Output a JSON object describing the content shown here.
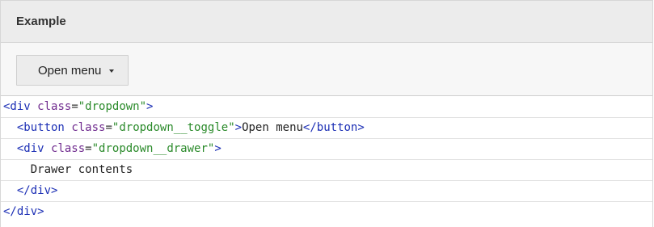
{
  "header": {
    "title": "Example"
  },
  "demo": {
    "button_label": "Open menu",
    "caret_icon": "caret-down-icon"
  },
  "code": {
    "lines": [
      [
        {
          "t": "tag",
          "v": "<div"
        },
        {
          "t": "text",
          "v": " "
        },
        {
          "t": "attr",
          "v": "class"
        },
        {
          "t": "eq",
          "v": "="
        },
        {
          "t": "str",
          "v": "\"dropdown\""
        },
        {
          "t": "tag",
          "v": ">"
        }
      ],
      [
        {
          "t": "text",
          "v": "  "
        },
        {
          "t": "tag",
          "v": "<button"
        },
        {
          "t": "text",
          "v": " "
        },
        {
          "t": "attr",
          "v": "class"
        },
        {
          "t": "eq",
          "v": "="
        },
        {
          "t": "str",
          "v": "\"dropdown__toggle\""
        },
        {
          "t": "tag",
          "v": ">"
        },
        {
          "t": "text",
          "v": "Open menu"
        },
        {
          "t": "tag",
          "v": "</button>"
        }
      ],
      [
        {
          "t": "text",
          "v": "  "
        },
        {
          "t": "tag",
          "v": "<div"
        },
        {
          "t": "text",
          "v": " "
        },
        {
          "t": "attr",
          "v": "class"
        },
        {
          "t": "eq",
          "v": "="
        },
        {
          "t": "str",
          "v": "\"dropdown__drawer\""
        },
        {
          "t": "tag",
          "v": ">"
        }
      ],
      [
        {
          "t": "text",
          "v": "    Drawer contents"
        }
      ],
      [
        {
          "t": "text",
          "v": "  "
        },
        {
          "t": "tag",
          "v": "</div>"
        }
      ],
      [
        {
          "t": "tag",
          "v": "</div>"
        }
      ]
    ]
  },
  "colors": {
    "tag": "#1c2fb5",
    "attr": "#6f2a8e",
    "string": "#2a8a2a",
    "header_bg": "#ececec",
    "demo_bg": "#f7f7f7"
  }
}
